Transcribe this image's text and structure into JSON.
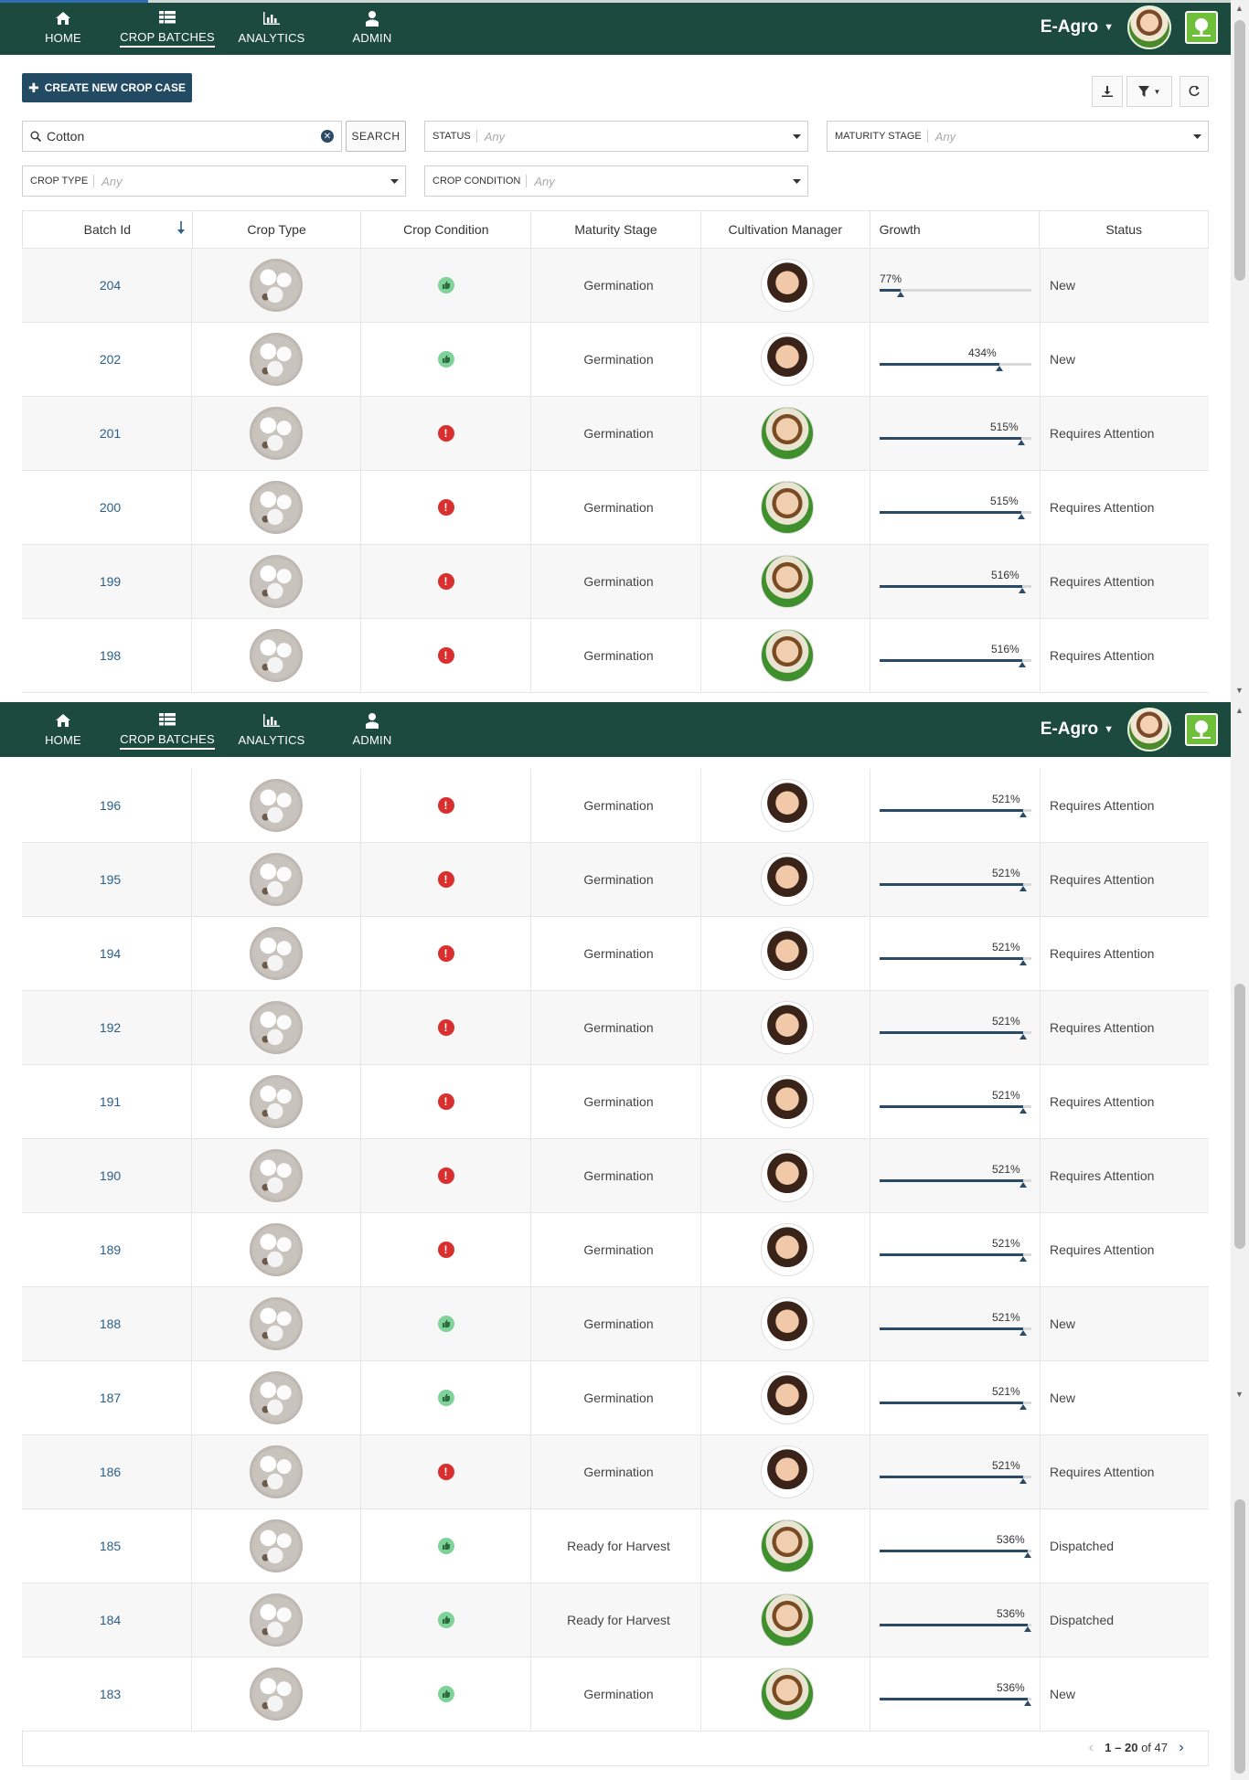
{
  "nav": {
    "items": [
      {
        "label": "HOME",
        "icon": "home-icon"
      },
      {
        "label": "CROP BATCHES",
        "icon": "list-icon"
      },
      {
        "label": "ANALYTICS",
        "icon": "bar-chart-icon"
      },
      {
        "label": "ADMIN",
        "icon": "admin-icon"
      }
    ],
    "active": "CROP BATCHES",
    "brand": "E-Agro"
  },
  "toolbar": {
    "create_label": "CREATE NEW CROP CASE"
  },
  "filters": {
    "search_value": "Cotton",
    "search_button": "SEARCH",
    "status_label": "STATUS",
    "status_value": "Any",
    "maturity_label": "MATURITY STAGE",
    "maturity_value": "Any",
    "crop_type_label": "CROP TYPE",
    "crop_type_value": "Any",
    "crop_condition_label": "CROP CONDITION",
    "crop_condition_value": "Any"
  },
  "table": {
    "columns": [
      "Batch Id",
      "Crop Type",
      "Crop Condition",
      "Maturity Stage",
      "Cultivation Manager",
      "Growth",
      "Status"
    ],
    "sort_column": "Batch Id",
    "sort_direction": "descending",
    "rows_top": [
      {
        "id": "204",
        "condition": "good",
        "maturity": "Germination",
        "manager": "female",
        "growth": "77%",
        "growth_value": 0.77,
        "status": "New"
      },
      {
        "id": "202",
        "condition": "good",
        "maturity": "Germination",
        "manager": "female",
        "growth": "434%",
        "growth_value": 4.34,
        "status": "New"
      },
      {
        "id": "201",
        "condition": "bad",
        "maturity": "Germination",
        "manager": "male",
        "growth": "515%",
        "growth_value": 5.15,
        "status": "Requires Attention"
      },
      {
        "id": "200",
        "condition": "bad",
        "maturity": "Germination",
        "manager": "male",
        "growth": "515%",
        "growth_value": 5.15,
        "status": "Requires Attention"
      },
      {
        "id": "199",
        "condition": "bad",
        "maturity": "Germination",
        "manager": "male",
        "growth": "516%",
        "growth_value": 5.16,
        "status": "Requires Attention"
      },
      {
        "id": "198",
        "condition": "bad",
        "maturity": "Germination",
        "manager": "male",
        "growth": "516%",
        "growth_value": 5.16,
        "status": "Requires Attention"
      }
    ],
    "rows_bottom": [
      {
        "id": "196",
        "condition": "bad",
        "maturity": "Germination",
        "manager": "female",
        "growth": "521%",
        "growth_value": 5.21,
        "status": "Requires Attention"
      },
      {
        "id": "195",
        "condition": "bad",
        "maturity": "Germination",
        "manager": "female",
        "growth": "521%",
        "growth_value": 5.21,
        "status": "Requires Attention"
      },
      {
        "id": "194",
        "condition": "bad",
        "maturity": "Germination",
        "manager": "female",
        "growth": "521%",
        "growth_value": 5.21,
        "status": "Requires Attention"
      },
      {
        "id": "192",
        "condition": "bad",
        "maturity": "Germination",
        "manager": "female",
        "growth": "521%",
        "growth_value": 5.21,
        "status": "Requires Attention"
      },
      {
        "id": "191",
        "condition": "bad",
        "maturity": "Germination",
        "manager": "female",
        "growth": "521%",
        "growth_value": 5.21,
        "status": "Requires Attention"
      },
      {
        "id": "190",
        "condition": "bad",
        "maturity": "Germination",
        "manager": "female",
        "growth": "521%",
        "growth_value": 5.21,
        "status": "Requires Attention"
      },
      {
        "id": "189",
        "condition": "bad",
        "maturity": "Germination",
        "manager": "female",
        "growth": "521%",
        "growth_value": 5.21,
        "status": "Requires Attention"
      },
      {
        "id": "188",
        "condition": "good",
        "maturity": "Germination",
        "manager": "female",
        "growth": "521%",
        "growth_value": 5.21,
        "status": "New"
      },
      {
        "id": "187",
        "condition": "good",
        "maturity": "Germination",
        "manager": "female",
        "growth": "521%",
        "growth_value": 5.21,
        "status": "New"
      },
      {
        "id": "186",
        "condition": "bad",
        "maturity": "Germination",
        "manager": "female",
        "growth": "521%",
        "growth_value": 5.21,
        "status": "Requires Attention"
      },
      {
        "id": "185",
        "condition": "good",
        "maturity": "Ready for Harvest",
        "manager": "male",
        "growth": "536%",
        "growth_value": 5.36,
        "status": "Dispatched"
      },
      {
        "id": "184",
        "condition": "good",
        "maturity": "Ready for Harvest",
        "manager": "male",
        "growth": "536%",
        "growth_value": 5.36,
        "status": "Dispatched"
      },
      {
        "id": "183",
        "condition": "good",
        "maturity": "Germination",
        "manager": "male",
        "growth": "536%",
        "growth_value": 5.36,
        "status": "New"
      }
    ]
  },
  "pager": {
    "range": "1 – 20",
    "of_label": "of 47"
  },
  "colors": {
    "navbar": "#1d4a3f",
    "primary_button": "#224a62",
    "link": "#2b5f8a",
    "condition_good": "#7ed398",
    "condition_bad": "#d9302f",
    "growth_bar": "#2b4a66"
  }
}
